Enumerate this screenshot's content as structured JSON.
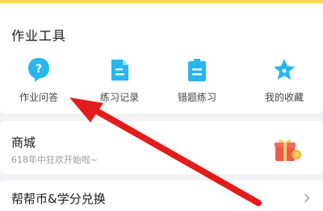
{
  "colors": {
    "top_accent": "#ffd84a",
    "icon_blue": "#27b6f0",
    "arrow_red": "#e31b1b",
    "gift_red": "#f05a4a",
    "coin_yellow": "#f6b23a"
  },
  "tools_section": {
    "title": "作业工具",
    "items": [
      {
        "label": "作业问答",
        "icon": "question-bubble-icon"
      },
      {
        "label": "练习记录",
        "icon": "record-document-icon"
      },
      {
        "label": "错题练习",
        "icon": "mistake-practice-icon"
      },
      {
        "label": "我的收藏",
        "icon": "star-bookmark-icon"
      }
    ]
  },
  "mall": {
    "title": "商城",
    "subtitle": "618年中狂欢开始啦~",
    "icon": "gift-box-icon"
  },
  "redeem": {
    "title": "帮帮币&学分兑换",
    "icon": "chevron-right-icon"
  },
  "annotation": {
    "icon": "red-arrow-pointer"
  }
}
